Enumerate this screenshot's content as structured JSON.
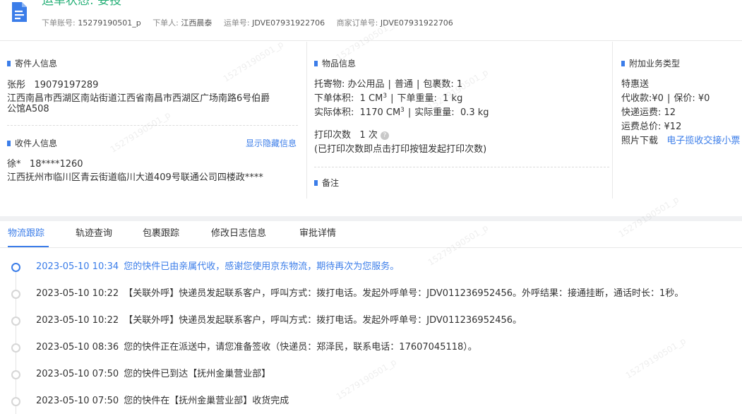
{
  "header": {
    "status_title": "运单状态: 妥投",
    "account_label": "下单账号:",
    "account_value": "15279190501_p",
    "orderer_label": "下单人:",
    "orderer_value": "江西晨泰",
    "waybill_label": "运单号:",
    "waybill_value": "JDVE07931922706",
    "merchant_order_label": "商家订单号:",
    "merchant_order_value": "JDVE07931922706"
  },
  "sender": {
    "section_title": "寄件人信息",
    "name": "张彤",
    "phone": "19079197289",
    "address_line1": "江西南昌市西湖区南站街道江西省南昌市西湖区广场南路6号伯爵",
    "address_line2": "公馆A508"
  },
  "receiver": {
    "section_title": "收件人信息",
    "show_hidden_link": "显示隐藏信息",
    "name": "徐*",
    "phone": "18****1260",
    "address": "江西抚州市临川区青云街道临川大道409号联通公司四楼政****"
  },
  "goods": {
    "section_title": "物品信息",
    "goods_label": "托寄物:",
    "goods_value": "办公用品",
    "service_value": "普通",
    "package_label": "包裹数:",
    "package_value": "1",
    "order_volume_label": "下单体积:",
    "order_volume_value": "1 CM",
    "order_weight_label": "下单重量:",
    "order_weight_value": "1 kg",
    "actual_volume_label": "实际体积:",
    "actual_volume_value": "1170 CM",
    "actual_weight_label": "实际重量:",
    "actual_weight_value": "0.3 kg",
    "cube_sup": "3",
    "print_label": "打印次数",
    "print_value": "1 次",
    "print_help_mark": "?",
    "print_note": "(已打印次数即点击打印按钮发起打印次数)",
    "remark_title": "备注"
  },
  "extra": {
    "section_title": "附加业务类型",
    "special_delivery": "特惠送",
    "cod_label": "代收款:",
    "cod_value": "¥0",
    "insured_label": "保价:",
    "insured_value": "¥0",
    "freight_label": "快递运费:",
    "freight_value": "12",
    "total_label": "运费总价:",
    "total_value": "¥12",
    "photo_label": "照片下载",
    "photo_link": "电子揽收交接小票"
  },
  "tabs": [
    "物流跟踪",
    "轨迹查询",
    "包裹跟踪",
    "修改日志信息",
    "审批详情"
  ],
  "timeline": [
    {
      "time": "2023-05-10 10:34",
      "text": "您的快件已由亲属代收，感谢您使用京东物流，期待再次为您服务。"
    },
    {
      "time": "2023-05-10 10:22",
      "text": "【关联外呼】快递员发起联系客户，呼叫方式：拨打电话。发起外呼单号：JDV011236952456。外呼结果：接通挂断，通话时长：1秒。"
    },
    {
      "time": "2023-05-10 10:22",
      "text": "【关联外呼】快递员发起联系客户，呼叫方式：拨打电话。发起外呼单号：JDV011236952456。"
    },
    {
      "time": "2023-05-10 08:36",
      "text": "您的快件正在派送中，请您准备签收（快递员：郑泽民，联系电话：17607045118）。"
    },
    {
      "time": "2023-05-10 07:50",
      "text": "您的快件已到达【抚州金巢营业部】"
    },
    {
      "time": "2023-05-10 07:50",
      "text": "您的快件在【抚州金巢营业部】收货完成"
    }
  ],
  "watermark_text": "15279190501_p",
  "colors": {
    "accent": "#3b7de9",
    "status_green": "#2ab17a"
  }
}
